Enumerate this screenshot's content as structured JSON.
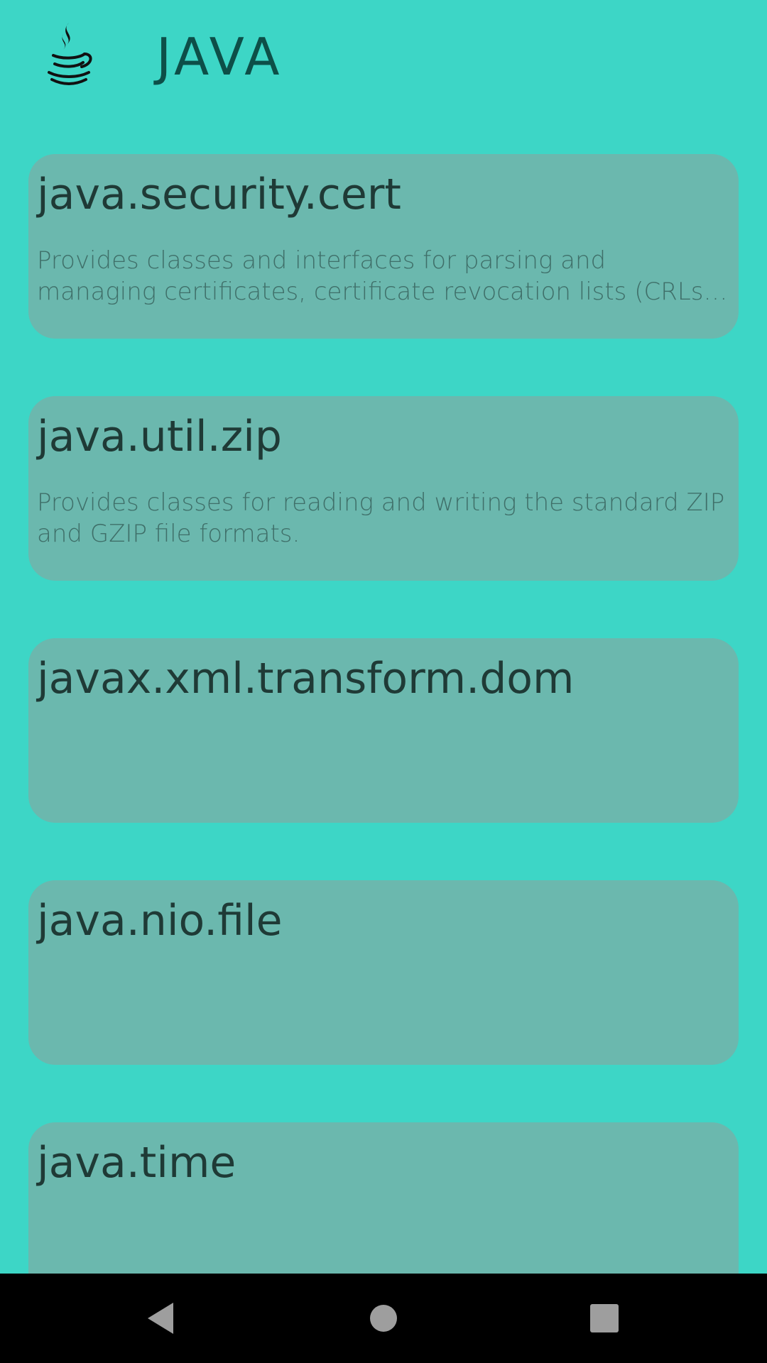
{
  "app": {
    "title": "JAVA",
    "logo_icon": "java-coffee-cup-icon"
  },
  "colors": {
    "background": "#3dd6c6",
    "card": "#6bb8ae",
    "title_text": "#0d4f48",
    "card_title_text": "#1f3a36",
    "card_desc_text": "#3f6f69",
    "navbar": "#000000",
    "nav_icon": "#9e9e9e"
  },
  "packages": [
    {
      "name": "java.security.cert",
      "description": "Provides classes and interfaces for parsing and managing certificates, certificate revocation lists (CRLs), and certification paths."
    },
    {
      "name": "java.util.zip",
      "description": "Provides classes for reading and writing the standard ZIP and GZIP file formats."
    },
    {
      "name": "javax.xml.transform.dom",
      "description": ""
    },
    {
      "name": "java.nio.file",
      "description": ""
    },
    {
      "name": "java.time",
      "description": ""
    }
  ],
  "navbar": {
    "back_icon": "back-triangle-icon",
    "home_icon": "home-circle-icon",
    "recents_icon": "recents-square-icon"
  }
}
